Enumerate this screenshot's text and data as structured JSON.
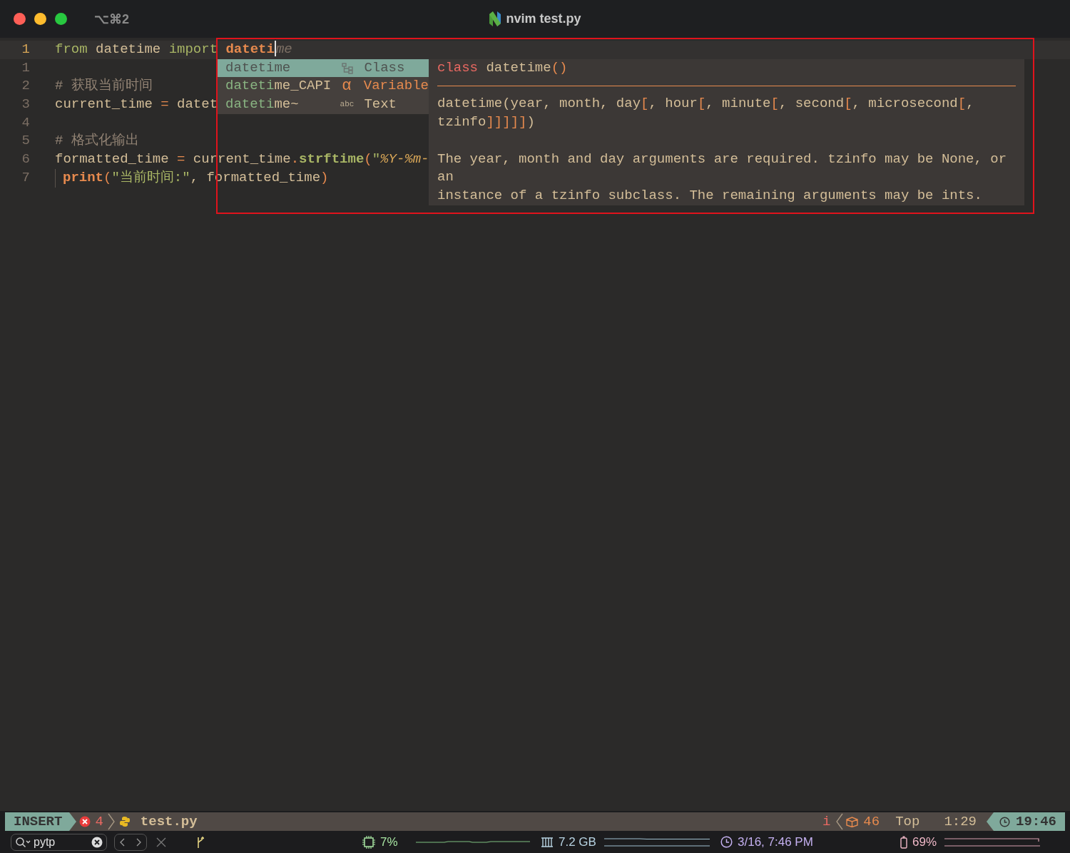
{
  "window": {
    "shortcut": "⌥⌘2",
    "title": "nvim test.py"
  },
  "editor": {
    "lines": [
      {
        "number": "1",
        "current": true,
        "indent_guide": false,
        "tokens": [
          {
            "text": "from",
            "kind": "keyword"
          },
          {
            "text": " datetime ",
            "kind": "plain"
          },
          {
            "text": "import",
            "kind": "keyword"
          },
          {
            "text": " dateti",
            "kind": "typed"
          },
          {
            "text": "me",
            "kind": "ghost"
          }
        ]
      },
      {
        "number": "1",
        "current": false,
        "indent_guide": false
      },
      {
        "number": "2",
        "current": false,
        "indent_guide": false,
        "tokens": [
          {
            "text": "# 获取当前时间",
            "kind": "comment"
          }
        ]
      },
      {
        "number": "3",
        "current": false,
        "indent_guide": false,
        "tokens": [
          {
            "text": "current_time ",
            "kind": "plain"
          },
          {
            "text": "=",
            "kind": "operator"
          },
          {
            "text": " datet",
            "kind": "plain"
          }
        ]
      },
      {
        "number": "4",
        "current": false,
        "indent_guide": false
      },
      {
        "number": "5",
        "current": false,
        "indent_guide": false,
        "tokens": [
          {
            "text": "# 格式化输出",
            "kind": "comment"
          }
        ]
      },
      {
        "number": "6",
        "current": false,
        "indent_guide": false,
        "tokens": [
          {
            "text": "formatted_time ",
            "kind": "plain"
          },
          {
            "text": "=",
            "kind": "operator"
          },
          {
            "text": " current_time",
            "kind": "plain"
          },
          {
            "text": ".",
            "kind": "operator"
          },
          {
            "text": "strftime",
            "kind": "function"
          },
          {
            "text": "(",
            "kind": "paren"
          },
          {
            "text": "\"",
            "kind": "string"
          },
          {
            "text": "%Y-%m-",
            "kind": "format"
          }
        ]
      },
      {
        "number": "7",
        "current": false,
        "indent_guide": true,
        "tokens": [
          {
            "text": "print",
            "kind": "builtin"
          },
          {
            "text": "(",
            "kind": "paren"
          },
          {
            "text": "\"当前时间:\"",
            "kind": "string"
          },
          {
            "text": ", formatted_time",
            "kind": "plain"
          },
          {
            "text": ")",
            "kind": "paren"
          }
        ]
      }
    ]
  },
  "completion_menu": {
    "items": [
      {
        "match": "dateti",
        "rest": "me",
        "kind": "class",
        "label": "Class",
        "selected": true
      },
      {
        "match": "dateti",
        "rest": "me_CAPI",
        "kind": "variable",
        "symbol": "α",
        "label": "Variable",
        "selected": false
      },
      {
        "match": "dateti",
        "rest": "me~",
        "kind": "text",
        "symbol": "abc",
        "label": "Text",
        "selected": false
      }
    ]
  },
  "documentation": {
    "header": [
      {
        "text": "class",
        "kind": "keyword_red"
      },
      {
        "text": " datetime",
        "kind": "plain"
      },
      {
        "text": "()",
        "kind": "paren"
      }
    ],
    "signature": [
      [
        {
          "text": "datetime(year, month, day",
          "kind": "plain"
        },
        {
          "text": "[",
          "kind": "paren"
        },
        {
          "text": ", hour",
          "kind": "plain"
        },
        {
          "text": "[",
          "kind": "paren"
        },
        {
          "text": ", minute",
          "kind": "plain"
        },
        {
          "text": "[",
          "kind": "paren"
        },
        {
          "text": ", second",
          "kind": "plain"
        },
        {
          "text": "[",
          "kind": "paren"
        },
        {
          "text": ", microsecond",
          "kind": "plain"
        },
        {
          "text": "[",
          "kind": "paren"
        },
        {
          "text": ",",
          "kind": "plain"
        }
      ],
      [
        {
          "text": "tzinfo",
          "kind": "plain"
        },
        {
          "text": "]]]]]",
          "kind": "paren"
        },
        {
          "text": ")",
          "kind": "plain"
        }
      ]
    ],
    "description": [
      "The year, month and day arguments are required. tzinfo may be None, or",
      "an",
      "instance of a tzinfo subclass. The remaining arguments may be ints."
    ]
  },
  "status_line": {
    "mode": "INSERT",
    "errors": "4",
    "file": "test.py",
    "info": "i",
    "symbols": "46",
    "position": "Top",
    "cursor": "1:29",
    "time": "19:46"
  },
  "bottom_bar": {
    "search": "pytp",
    "cpu": "7%",
    "memory": "7.2 GB",
    "clock": "3/16, 7:46 PM",
    "battery": "69%"
  }
}
